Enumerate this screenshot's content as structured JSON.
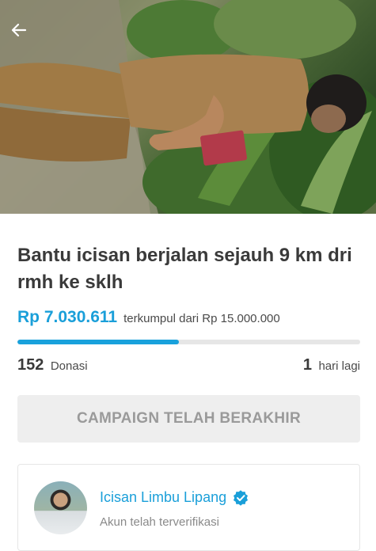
{
  "campaign": {
    "title": "Bantu icisan berjalan sejauh 9 km dri rmh ke sklh",
    "collected": "Rp 7.030.611",
    "collected_suffix": "terkumpul dari Rp 15.000.000",
    "progress_fraction": 0.47,
    "donations_count": "152",
    "donations_label": "Donasi",
    "days_left_count": "1",
    "days_left_label": "hari lagi",
    "status_button": "CAMPAIGN TELAH BERAKHIR"
  },
  "organizer": {
    "name": "Icisan Limbu Lipang",
    "status": "Akun telah terverifikasi"
  },
  "icons": {
    "back": "back-arrow-icon",
    "verified": "verified-badge-icon"
  },
  "colors": {
    "accent": "#1a9fd9",
    "title": "#3a3a3a",
    "disabled_button_bg": "#eeeeee",
    "disabled_button_text": "#9a9a9a"
  }
}
